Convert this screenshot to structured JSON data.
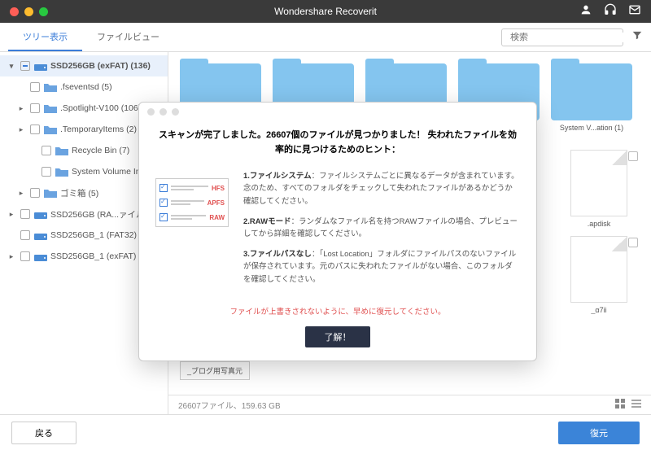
{
  "app": {
    "title": "Wondershare Recoverit"
  },
  "tabs": {
    "tree": "ツリー表示",
    "file": "ファイルビュー"
  },
  "search": {
    "placeholder": "検索"
  },
  "sidebar": {
    "items": [
      {
        "label": "SSD256GB (exFAT) (136)",
        "level": 0,
        "exp": "▾",
        "cb": "partial",
        "icon": "drive",
        "selected": true
      },
      {
        "label": ".fseventsd (5)",
        "level": 1,
        "exp": "",
        "cb": "",
        "icon": "folder"
      },
      {
        "label": ".Spotlight-V100 (106)",
        "level": 1,
        "exp": "▸",
        "cb": "",
        "icon": "folder"
      },
      {
        "label": ".TemporaryItems (2)",
        "level": 1,
        "exp": "▸",
        "cb": "",
        "icon": "folder"
      },
      {
        "label": "Recycle Bin (7)",
        "level": 2,
        "exp": "",
        "cb": "",
        "icon": "folder"
      },
      {
        "label": "System Volume Inform",
        "level": 2,
        "exp": "",
        "cb": "",
        "icon": "folder"
      },
      {
        "label": "ゴミ箱 (5)",
        "level": 1,
        "exp": "▸",
        "cb": "",
        "icon": "folder"
      },
      {
        "label": "SSD256GB (RA...ァイル)",
        "level": 0,
        "exp": "▸",
        "cb": "",
        "icon": "drive"
      },
      {
        "label": "SSD256GB_1 (FAT32) (",
        "level": 0,
        "exp": "",
        "cb": "",
        "icon": "drive"
      },
      {
        "label": "SSD256GB_1 (exFAT) (1",
        "level": 0,
        "exp": "▸",
        "cb": "",
        "icon": "drive"
      }
    ]
  },
  "grid": {
    "row1": [
      {
        "type": "folder",
        "label": ""
      },
      {
        "type": "folder",
        "label": ""
      },
      {
        "type": "folder",
        "label": ""
      },
      {
        "type": "folder",
        "label": ""
      },
      {
        "type": "folder",
        "label": "System V...ation (1)"
      }
    ],
    "row2": [
      {
        "type": "file",
        "label": ".apdisk"
      },
      {
        "type": "file",
        "label": "_α7ii"
      }
    ],
    "extra": "_ブログ用写真元"
  },
  "status": {
    "text": "26607ファイル、159.63 GB"
  },
  "footer": {
    "back": "戻る",
    "recover": "復元"
  },
  "modal": {
    "title": "スキャンが完了しました。26607個のファイルが見つかりました！ 失われたファイルを効率的に見つけるためのヒント：",
    "illust": {
      "t1": "HFS",
      "t2": "APFS",
      "t3": "RAW"
    },
    "h1": "1.ファイルシステム",
    "p1": "：ファイルシステムごとに異なるデータが含まれています。念のため、すべてのフォルダをチェックして失われたファイルがあるかどうか確認してください。",
    "h2": "2.RAWモード",
    "p2": "：ランダムなファイル名を持つRAWファイルの場合、プレビューしてから詳細を確認してください。",
    "h3": "3.ファイルパスなし",
    "p3": "：「Lost Location」フォルダにファイルパスのないファイルが保存されています。元のパスに失われたファイルがない場合、このフォルダを確認してください。",
    "warning": "ファイルが上書きされないように、早めに復元してください。",
    "ok": "了解！"
  }
}
